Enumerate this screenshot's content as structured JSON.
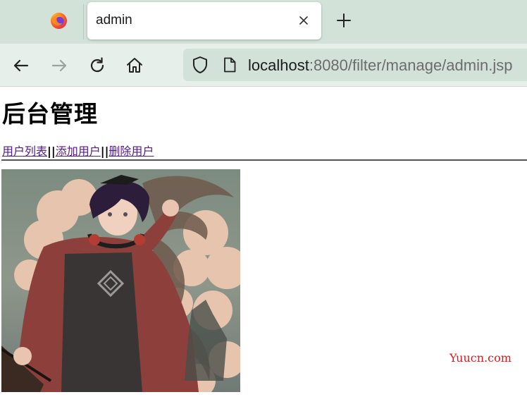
{
  "browser": {
    "tab_title": "admin",
    "url_host": "localhost",
    "url_path": ":8080/filter/manage/admin.jsp"
  },
  "page": {
    "heading": "后台管理",
    "links": [
      {
        "label": "用户列表"
      },
      {
        "label": "添加用户"
      },
      {
        "label": "删除用户"
      }
    ],
    "separator": "||",
    "watermark": "Yuucn.com"
  },
  "icons": {
    "browser_logo": "firefox-logo",
    "tab_close": "close-icon",
    "new_tab": "plus-icon",
    "back": "back-arrow-icon",
    "forward": "forward-arrow-icon",
    "reload": "reload-icon",
    "home": "home-icon",
    "tracking": "shield-icon",
    "page_info": "page-icon"
  },
  "colors": {
    "chrome_bg": "#d3e2d9",
    "navbar_bg": "#e6efe9",
    "link_visited": "#551a8b",
    "watermark": "#e0151b"
  }
}
